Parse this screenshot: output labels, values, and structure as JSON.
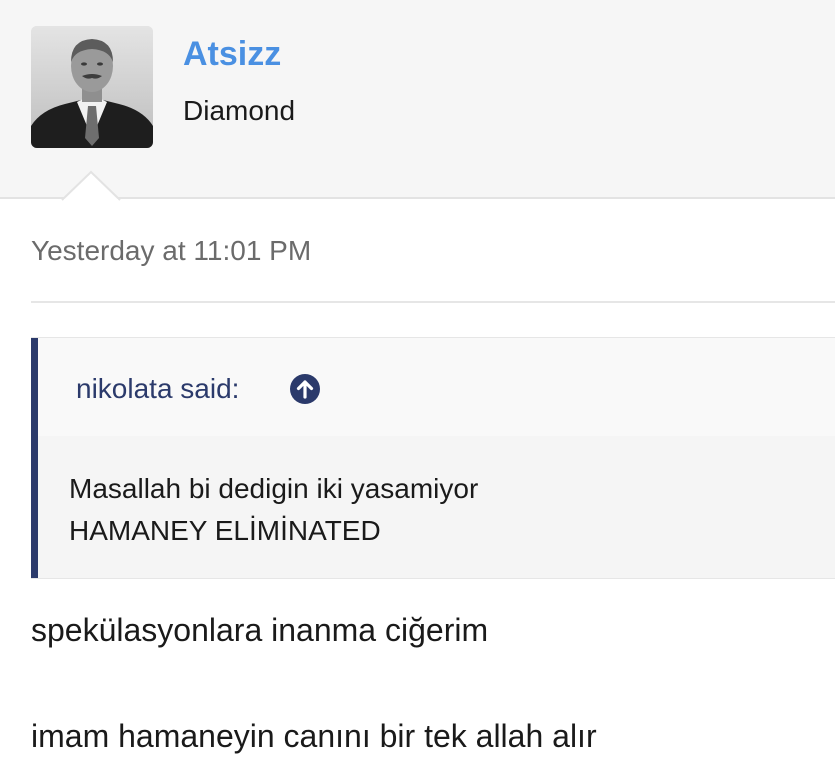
{
  "post": {
    "author": {
      "username": "Atsizz",
      "title": "Diamond"
    },
    "timestamp": "Yesterday at 11:01 PM",
    "quote": {
      "attribution": "nikolata said:",
      "jump_icon": "arrow-up-circle-icon",
      "lines": [
        "Masallah bi dedigin iki yasamiyor",
        "HAMANEY ELİMİNATED"
      ]
    },
    "reply_lines": [
      "spekülasyonlara inanma ciğerim",
      "imam hamaneyin canını bir tek allah alır"
    ]
  },
  "colors": {
    "username": "#4a90e2",
    "quote_bar": "#2b3a6b",
    "header_bg": "#f6f6f6",
    "quote_bg": "#f5f5f5",
    "text": "#1a1a1a",
    "muted": "#6b6b6b"
  }
}
